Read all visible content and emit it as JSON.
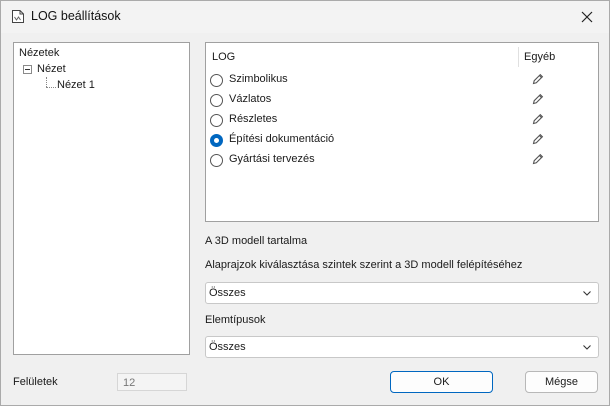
{
  "window": {
    "title": "LOG beállítások"
  },
  "tree": {
    "root": "Nézetek",
    "children": [
      {
        "label": "Nézet",
        "children": [
          {
            "label": "Nézet 1"
          }
        ]
      }
    ]
  },
  "log_table": {
    "header_log": "LOG",
    "header_other": "Egyéb",
    "rows": [
      {
        "label": "Szimbolikus",
        "selected": false,
        "icon": "pencil-icon"
      },
      {
        "label": "Vázlatos",
        "selected": false,
        "icon": "pencil-icon"
      },
      {
        "label": "Részletes",
        "selected": false,
        "icon": "pencil-icon"
      },
      {
        "label": "Építési dokumentáció",
        "selected": true,
        "icon": "pencil-icon"
      },
      {
        "label": "Gyártási tervezés",
        "selected": false,
        "icon": "pencil-icon"
      }
    ]
  },
  "model_content": {
    "title": "A 3D modell tartalma",
    "floorplan_label": "Alaprajzok kiválasztása szintek szerint a 3D modell felépítéséhez",
    "floorplan_value": "Összes",
    "element_types_label": "Elemtípusok",
    "element_types_value": "Összes"
  },
  "surfaces": {
    "label": "Felületek",
    "value": "12"
  },
  "buttons": {
    "ok": "OK",
    "cancel": "Mégse"
  },
  "colors": {
    "accent": "#0067c0"
  }
}
